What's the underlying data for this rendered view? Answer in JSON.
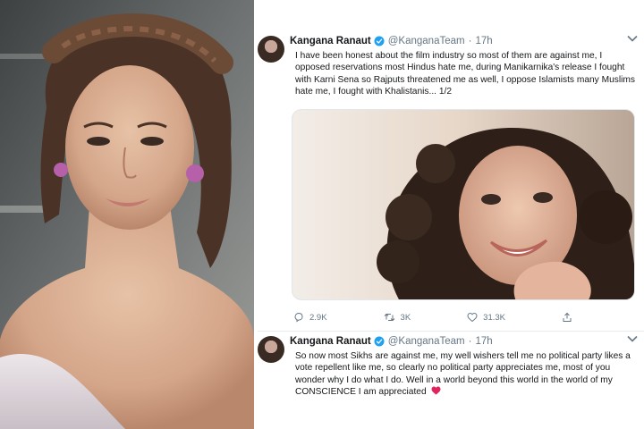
{
  "tweets": [
    {
      "author": "Kangana Ranaut",
      "handle": "@KanganaTeam",
      "time": "17h",
      "text": "I have been honest about the film industry so most of them are against me, I opposed reservations most Hindus hate me, during Manikarnika's release I fought with Karni Sena so Rajputs threatened me as well, I oppose Islamists many Muslims hate me, I fought with Khalistanis... 1/2",
      "actions": {
        "replies": "2.9K",
        "retweets": "3K",
        "likes": "31.3K"
      }
    },
    {
      "author": "Kangana Ranaut",
      "handle": "@KanganaTeam",
      "time": "17h",
      "text": "So now most Sikhs are against me, my well wishers tell me no political party likes a vote repellent like me, so clearly no political party appreciates me, most of you wonder why I do what I do. Well in a world beyond this world in the world of my CONSCIENCE I am appreciated"
    }
  ],
  "icons": {
    "verified": "verified-badge-icon",
    "reply": "reply-icon",
    "retweet": "retweet-icon",
    "like": "heart-icon",
    "share": "share-icon",
    "emoji": "red-heart-emoji"
  },
  "colors": {
    "verified": "#1da1f2",
    "meta": "#657786",
    "heart_emoji": "#e0245e"
  }
}
